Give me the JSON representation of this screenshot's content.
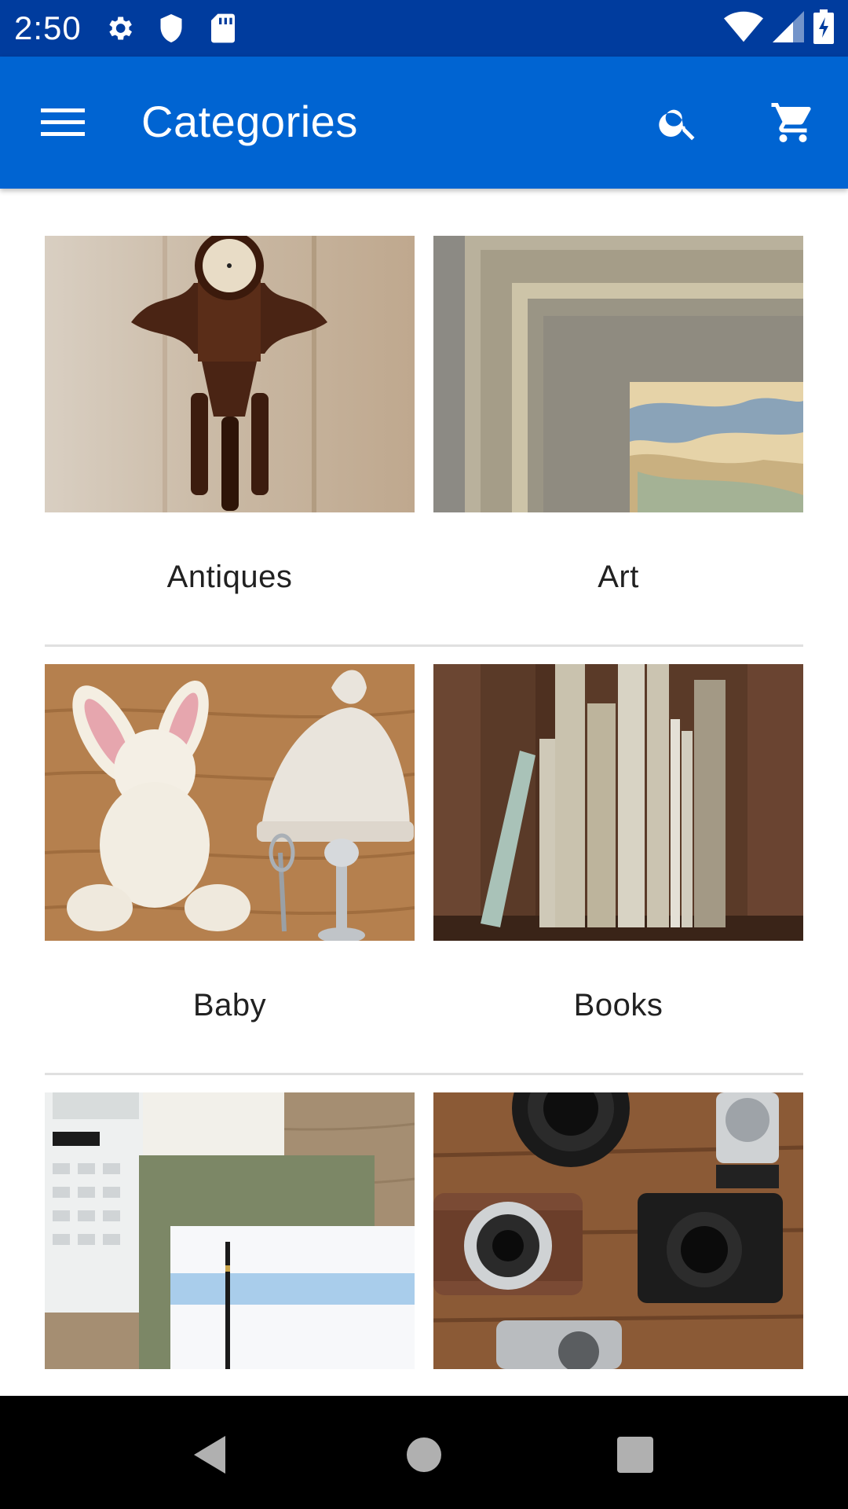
{
  "status_bar": {
    "time": "2:50",
    "icons": [
      "gear-icon",
      "shield-icon",
      "sd-card-icon"
    ],
    "right_icons": [
      "wifi-icon",
      "signal-icon",
      "battery-charging-icon"
    ]
  },
  "app_bar": {
    "title": "Categories",
    "icons": [
      "menu-icon",
      "search-icon",
      "cart-icon"
    ]
  },
  "categories": [
    {
      "label": "Antiques"
    },
    {
      "label": "Art"
    },
    {
      "label": "Baby"
    },
    {
      "label": "Books"
    },
    {
      "label": ""
    },
    {
      "label": ""
    }
  ],
  "nav_bar": {
    "icons": [
      "back-icon",
      "home-icon",
      "recents-icon"
    ]
  },
  "colors": {
    "status_bar": "#003c9e",
    "app_bar": "#0064d2",
    "nav_bar": "#000000"
  }
}
